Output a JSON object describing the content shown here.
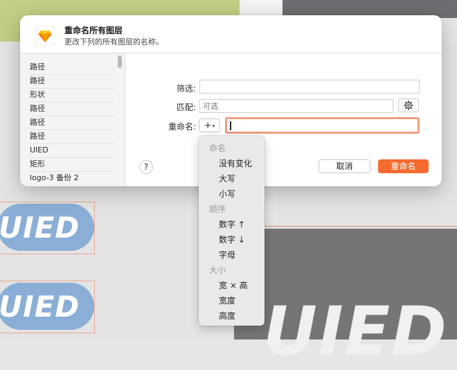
{
  "dialog": {
    "title": "重命名所有图层",
    "subtitle": "更改下列的所有图层的名称。"
  },
  "layers": [
    "路径",
    "路径",
    "形状",
    "路径",
    "路径",
    "路径",
    "UIED",
    "矩形",
    "logo-3 备份 2"
  ],
  "form": {
    "filter_label": "筛选:",
    "filter_value": "",
    "match_label": "匹配:",
    "match_placeholder": "可选",
    "rename_label": "重命名:",
    "rename_value": "",
    "plus_label": "+",
    "plus_arrow": "▾"
  },
  "buttons": {
    "help": "?",
    "cancel": "取消",
    "rename": "重命名"
  },
  "menu": {
    "naming_header": "命名",
    "no_change": "没有变化",
    "uppercase": "大写",
    "lowercase": "小写",
    "order_header": "顺序",
    "number_asc": "数字 ↑",
    "number_desc": "数字 ↓",
    "letter": "字母",
    "size_header": "大小",
    "width_height": "宽 × 高",
    "width": "宽度",
    "height": "高度"
  },
  "canvas": {
    "logo_text_1": "UIED",
    "logo_text_2": "UIED",
    "big_text": "UIED"
  },
  "colors": {
    "accent": "#f46a2f",
    "focus_ring": "#ee9e83",
    "logo_blue": "#8aaed6",
    "canvas_green": "#c2cf86"
  }
}
